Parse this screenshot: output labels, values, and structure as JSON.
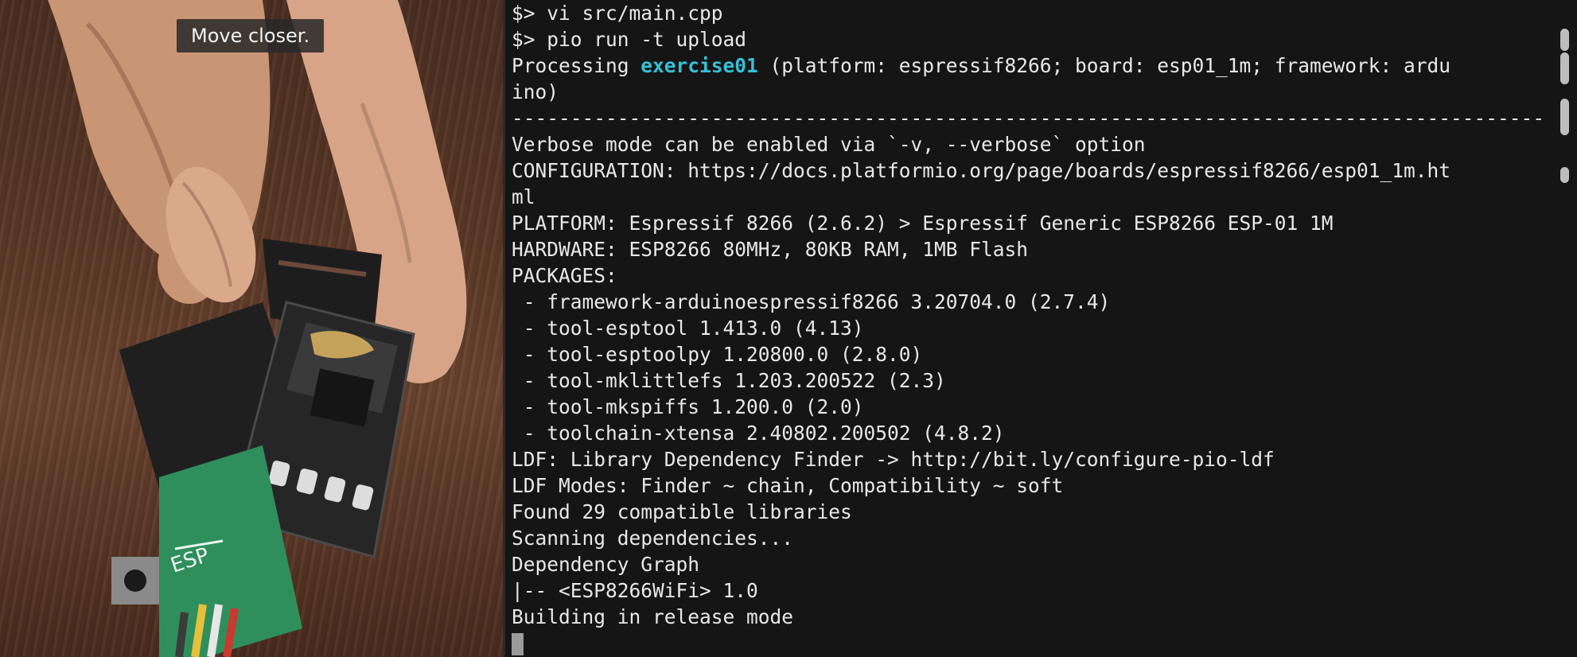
{
  "camera": {
    "caption": "Move closer."
  },
  "terminal": {
    "lines": [
      "$> vi src/main.cpp",
      "$> pio run -t upload",
      "",
      "ino)",
      "-----------------------------------------------------------------------------------------",
      "Verbose mode can be enabled via `-v, --verbose` option",
      "CONFIGURATION: https://docs.platformio.org/page/boards/espressif8266/esp01_1m.ht",
      "ml",
      "PLATFORM: Espressif 8266 (2.6.2) > Espressif Generic ESP8266 ESP-01 1M",
      "HARDWARE: ESP8266 80MHz, 80KB RAM, 1MB Flash",
      "PACKAGES:",
      " - framework-arduinoespressif8266 3.20704.0 (2.7.4)",
      " - tool-esptool 1.413.0 (4.13)",
      " - tool-esptoolpy 1.20800.0 (2.8.0)",
      " - tool-mklittlefs 1.203.200522 (2.3)",
      " - tool-mkspiffs 1.200.0 (2.0)",
      " - toolchain-xtensa 2.40802.200502 (4.8.2)",
      "LDF: Library Dependency Finder -> http://bit.ly/configure-pio-ldf",
      "LDF Modes: Finder ~ chain, Compatibility ~ soft",
      "Found 29 compatible libraries",
      "Scanning dependencies...",
      "Dependency Graph",
      "|-- <ESP8266WiFi> 1.0",
      "Building in release mode"
    ],
    "processing": {
      "prefix": "Processing ",
      "env": "exercise01",
      "suffix": " (platform: espressif8266; board: esp01_1m; framework: ardu"
    },
    "colors": {
      "background": "#151515",
      "text": "#e8e8e8",
      "highlight": "#36c0d6",
      "cursor": "#9a9a9a"
    }
  }
}
